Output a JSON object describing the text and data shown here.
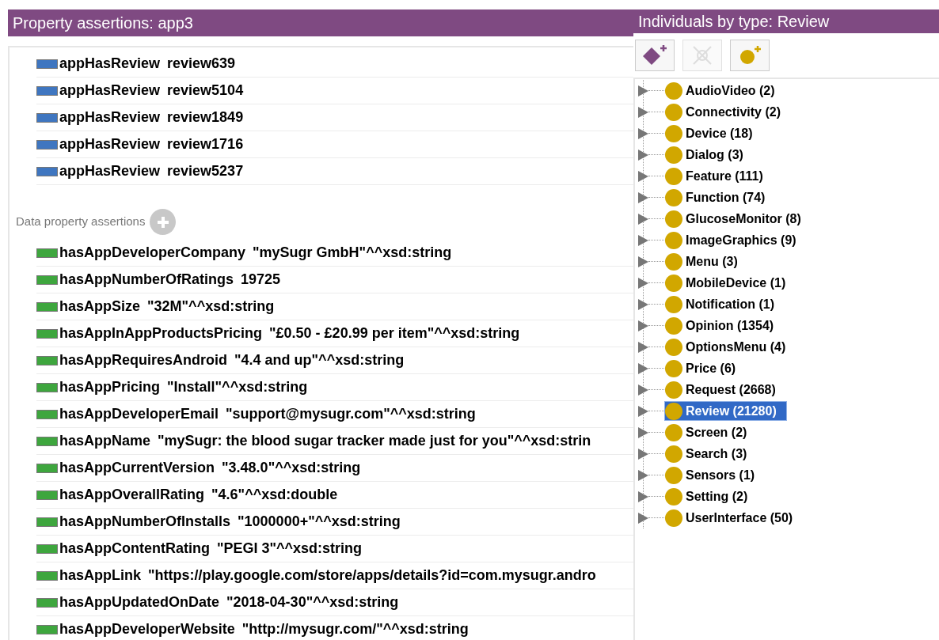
{
  "property_panel": {
    "title": "Property assertions: app3",
    "object_assertions": [
      {
        "property": "appHasReview",
        "value": "review639"
      },
      {
        "property": "appHasReview",
        "value": "review5104"
      },
      {
        "property": "appHasReview",
        "value": "review1849"
      },
      {
        "property": "appHasReview",
        "value": "review1716"
      },
      {
        "property": "appHasReview",
        "value": "review5237"
      }
    ],
    "data_section_label": "Data property assertions",
    "data_assertions": [
      {
        "property": "hasAppDeveloperCompany",
        "value": "\"mySugr GmbH\"^^xsd:string"
      },
      {
        "property": "hasAppNumberOfRatings",
        "value": "19725"
      },
      {
        "property": "hasAppSize",
        "value": "\"32M\"^^xsd:string"
      },
      {
        "property": "hasAppInAppProductsPricing",
        "value": "\"£0.50 - £20.99 per item\"^^xsd:string"
      },
      {
        "property": "hasAppRequiresAndroid",
        "value": "\"4.4 and up\"^^xsd:string"
      },
      {
        "property": "hasAppPricing",
        "value": "\"Install\"^^xsd:string"
      },
      {
        "property": "hasAppDeveloperEmail",
        "value": "\"support@mysugr.com\"^^xsd:string"
      },
      {
        "property": "hasAppName",
        "value": "\"mySugr: the blood sugar tracker made just for you\"^^xsd:strin"
      },
      {
        "property": "hasAppCurrentVersion",
        "value": "\"3.48.0\"^^xsd:string"
      },
      {
        "property": "hasAppOverallRating",
        "value": "\"4.6\"^^xsd:double"
      },
      {
        "property": "hasAppNumberOfInstalls",
        "value": "\"1000000+\"^^xsd:string"
      },
      {
        "property": "hasAppContentRating",
        "value": "\"PEGI 3\"^^xsd:string"
      },
      {
        "property": "hasAppLink",
        "value": "\"https://play.google.com/store/apps/details?id=com.mysugr.andro"
      },
      {
        "property": "hasAppUpdatedOnDate",
        "value": "\"2018-04-30\"^^xsd:string"
      },
      {
        "property": "hasAppDeveloperWebsite",
        "value": "\"http://mysugr.com/\"^^xsd:string"
      }
    ]
  },
  "individuals_panel": {
    "title": "Individuals by type: Review",
    "toolbar": [
      {
        "kind": "add-class",
        "disabled": false
      },
      {
        "kind": "delete",
        "disabled": true
      },
      {
        "kind": "add-individual",
        "disabled": false
      }
    ],
    "types": [
      {
        "label": "AudioVideo (2)",
        "selected": false
      },
      {
        "label": "Connectivity (2)",
        "selected": false
      },
      {
        "label": "Device (18)",
        "selected": false
      },
      {
        "label": "Dialog (3)",
        "selected": false
      },
      {
        "label": "Feature (111)",
        "selected": false
      },
      {
        "label": "Function (74)",
        "selected": false
      },
      {
        "label": "GlucoseMonitor (8)",
        "selected": false
      },
      {
        "label": "ImageGraphics (9)",
        "selected": false
      },
      {
        "label": "Menu (3)",
        "selected": false
      },
      {
        "label": "MobileDevice (1)",
        "selected": false
      },
      {
        "label": "Notification (1)",
        "selected": false
      },
      {
        "label": "Opinion (1354)",
        "selected": false
      },
      {
        "label": "OptionsMenu (4)",
        "selected": false
      },
      {
        "label": "Price (6)",
        "selected": false
      },
      {
        "label": "Request (2668)",
        "selected": false
      },
      {
        "label": "Review (21280)",
        "selected": true
      },
      {
        "label": "Screen (2)",
        "selected": false
      },
      {
        "label": "Search (3)",
        "selected": false
      },
      {
        "label": "Sensors (1)",
        "selected": false
      },
      {
        "label": "Setting (2)",
        "selected": false
      },
      {
        "label": "UserInterface (50)",
        "selected": false
      }
    ]
  }
}
